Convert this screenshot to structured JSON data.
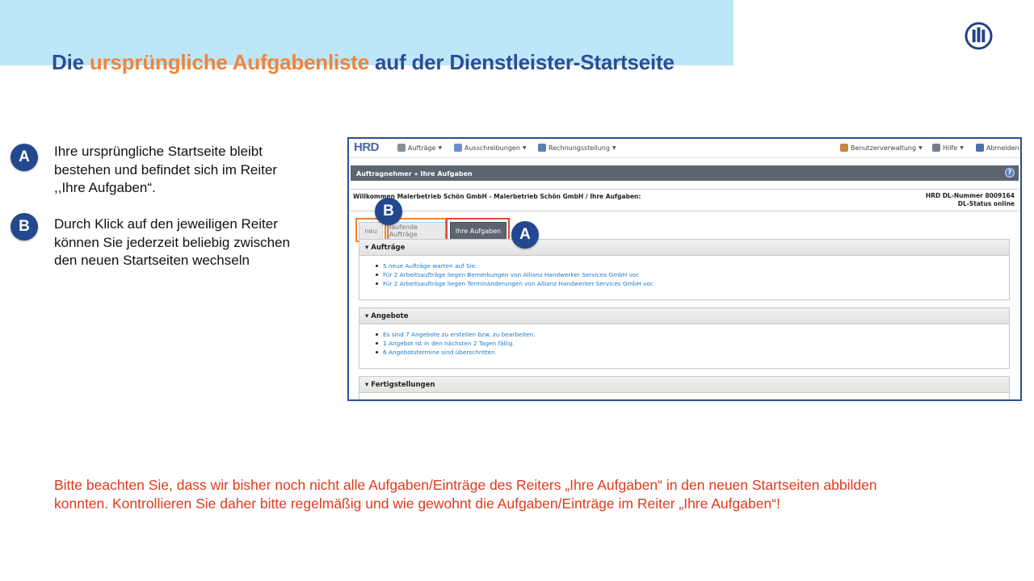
{
  "slide": {
    "title_part1": "Die ",
    "title_part2": "ursprüngliche Aufgabenliste",
    "title_part3": " auf der Dienstleister-Startseite",
    "logo_icon": "allianz-logo-icon",
    "colors": {
      "title_blue": "#2a4e96",
      "title_orange": "#f0843a",
      "notice_red": "#e03a1e",
      "badge_blue": "#22488f",
      "band": "#bde6f8"
    }
  },
  "bullets": [
    {
      "badge": "A",
      "lines": [
        "Ihre ursprüngliche Startseite bleibt",
        "bestehen und befindet sich im Reiter",
        ",,Ihre Aufgaben“."
      ]
    },
    {
      "badge": "B",
      "lines": [
        "Durch Klick auf den jeweiligen Reiter",
        "können Sie jederzeit beliebig zwischen",
        "den neuen Startseiten wechseln"
      ]
    }
  ],
  "screenshot": {
    "app_logo": "HRD",
    "nav": {
      "auftraege": "Aufträge",
      "ausschreibungen": "Ausschreibungen",
      "rechnungsstellung": "Rechnungsstellung",
      "benutzerverwaltung": "Benutzerverwaltung",
      "hilfe": "Hilfe",
      "abmelden": "Abmelden"
    },
    "breadcrumb": "Auftragnehmer » Ihre Aufgaben",
    "help_glyph": "?",
    "welcome": "Willkommen Malerbetrieb Schön GmbH - Malerbetrieb Schön GmbH / Ihre Aufgaben:",
    "dl_nummer": "HRD DL-Nummer 8009164",
    "dl_status": "DL-Status online",
    "tabs": {
      "neu": "neu",
      "laufende": "laufende Aufträge",
      "ihre": "Ihre Aufgaben"
    },
    "callouts": {
      "b": "B",
      "a": "A"
    },
    "panels": [
      {
        "title": "Aufträge",
        "items": [
          "5 neue Aufträge warten auf Sie.",
          "Für 2 Arbeitsaufträge liegen Bemerkungen von Allianz Handwerker Services GmbH vor.",
          "Für 2 Arbeitsaufträge liegen Terminänderungen von Allianz Handwerker Services GmbH vor."
        ]
      },
      {
        "title": "Angebote",
        "items": [
          "Es sind 7 Angebote zu erstellen bzw. zu bearbeiten.",
          "1 Angebot ist in den nächsten 2 Tagen fällig.",
          "6 Angebotstermine sind überschritten."
        ]
      },
      {
        "title": "Fertigstellungen",
        "items": []
      }
    ]
  },
  "notice": {
    "line1": "Bitte beachten Sie, dass wir bisher noch nicht alle Aufgaben/Einträge des Reiters „Ihre Aufgaben“ in den neuen Startseiten abbilden",
    "line2": "konnten. Kontrollieren Sie daher bitte regelmäßig und wie gewohnt die Aufgaben/Einträge im Reiter „Ihre Aufgaben“!"
  }
}
